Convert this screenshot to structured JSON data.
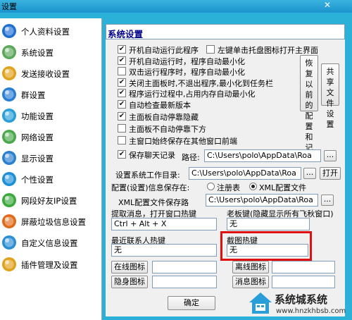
{
  "window": {
    "title": "设置",
    "close_glyph": "✕"
  },
  "sidebar": {
    "items": [
      {
        "label": "个人资料设置",
        "icon": "person-icon",
        "color": "#1f6fd1"
      },
      {
        "label": "系统设置",
        "icon": "system-icon",
        "color": "#5aa85a"
      },
      {
        "label": "发送接收设置",
        "icon": "send-receive-icon",
        "color": "#e0a21a"
      },
      {
        "label": "群设置",
        "icon": "group-icon",
        "color": "#2a7fd4"
      },
      {
        "label": "功能设置",
        "icon": "function-icon",
        "color": "#2a9ed8"
      },
      {
        "label": "网络设置",
        "icon": "network-icon",
        "color": "#4aa84a"
      },
      {
        "label": "显示设置",
        "icon": "display-icon",
        "color": "#2b7fd1"
      },
      {
        "label": "个性设置",
        "icon": "personalize-icon",
        "color": "#1c8fd8"
      },
      {
        "label": "网段好友IP设置",
        "icon": "ip-icon",
        "color": "#3ba83b"
      },
      {
        "label": "屏蔽垃圾信息设置",
        "icon": "block-spam-icon",
        "color": "#e06a1a"
      },
      {
        "label": "自定义信息设置",
        "icon": "custom-info-icon",
        "color": "#2a8ed6"
      },
      {
        "label": "插件管理及设置",
        "icon": "plugin-icon",
        "color": "#e0a21a"
      }
    ]
  },
  "main": {
    "section_title": "系统设置",
    "options": [
      {
        "label": "开机自动运行此程序",
        "checked": true
      },
      {
        "label": "左键单击托盘图标打开主界面",
        "checked": false
      },
      {
        "label": "开机自动运行时，程序自动最小化",
        "checked": true
      },
      {
        "label": "双击运行程序时，程序自动最小化",
        "checked": false
      },
      {
        "label": "关闭主面板时,不退出程序,最小化到任务栏",
        "checked": true
      },
      {
        "label": "程序运行过程中,占用内存自动最小化",
        "checked": true
      },
      {
        "label": "自动检查最新版本",
        "checked": true
      },
      {
        "label": "主面板自动停靠隐藏",
        "checked": true
      },
      {
        "label": "主面板不自动停靠下方",
        "checked": false
      },
      {
        "label": "主窗口始终保存在其他窗口前端",
        "checked": false
      },
      {
        "label": "保存聊天记录",
        "checked": true
      }
    ],
    "restore_button": "恢复以前的配置和记录",
    "share_button": "共享文件设置",
    "check_glyph": "✔",
    "path_label": "路径:",
    "path_value": "C:\\Users\\polo\\AppData\\Roa",
    "browse_label": "...",
    "workdir_label": "设置系统工作目录:",
    "workdir_value": "C:\\Users\\polo\\AppData\\Roa",
    "open_label": "打开",
    "config_save_label": "配置(设置)信息保存在:",
    "radio_registry": "注册表",
    "radio_xml": "XML配置文件",
    "radio_selected": "XML配置文件",
    "xml_path_label": "XML配置文件保存路",
    "xml_path_value": "C:\\Users\\polo\\AppData\\Roa",
    "hotkey_extract_label": "提取消息，打开窗口热键",
    "hotkey_extract_value": "Ctrl + Alt + X",
    "boss_key_label": "老板键(隐藏显示所有飞秋窗口)",
    "boss_key_value": "无",
    "recent_contact_label": "最近联系人热键",
    "recent_contact_value": "无",
    "screenshot_key_label": "截图热键",
    "screenshot_key_value": "无",
    "online_icon_label": "在线图标",
    "offline_icon_label": "离线图标",
    "hidden_icon_label": "隐身图标",
    "message_icon_label": "消息图标",
    "ok_label": "确定"
  },
  "watermark": {
    "title": "系统城系统",
    "url": "www.hnzkhbsb.com"
  }
}
